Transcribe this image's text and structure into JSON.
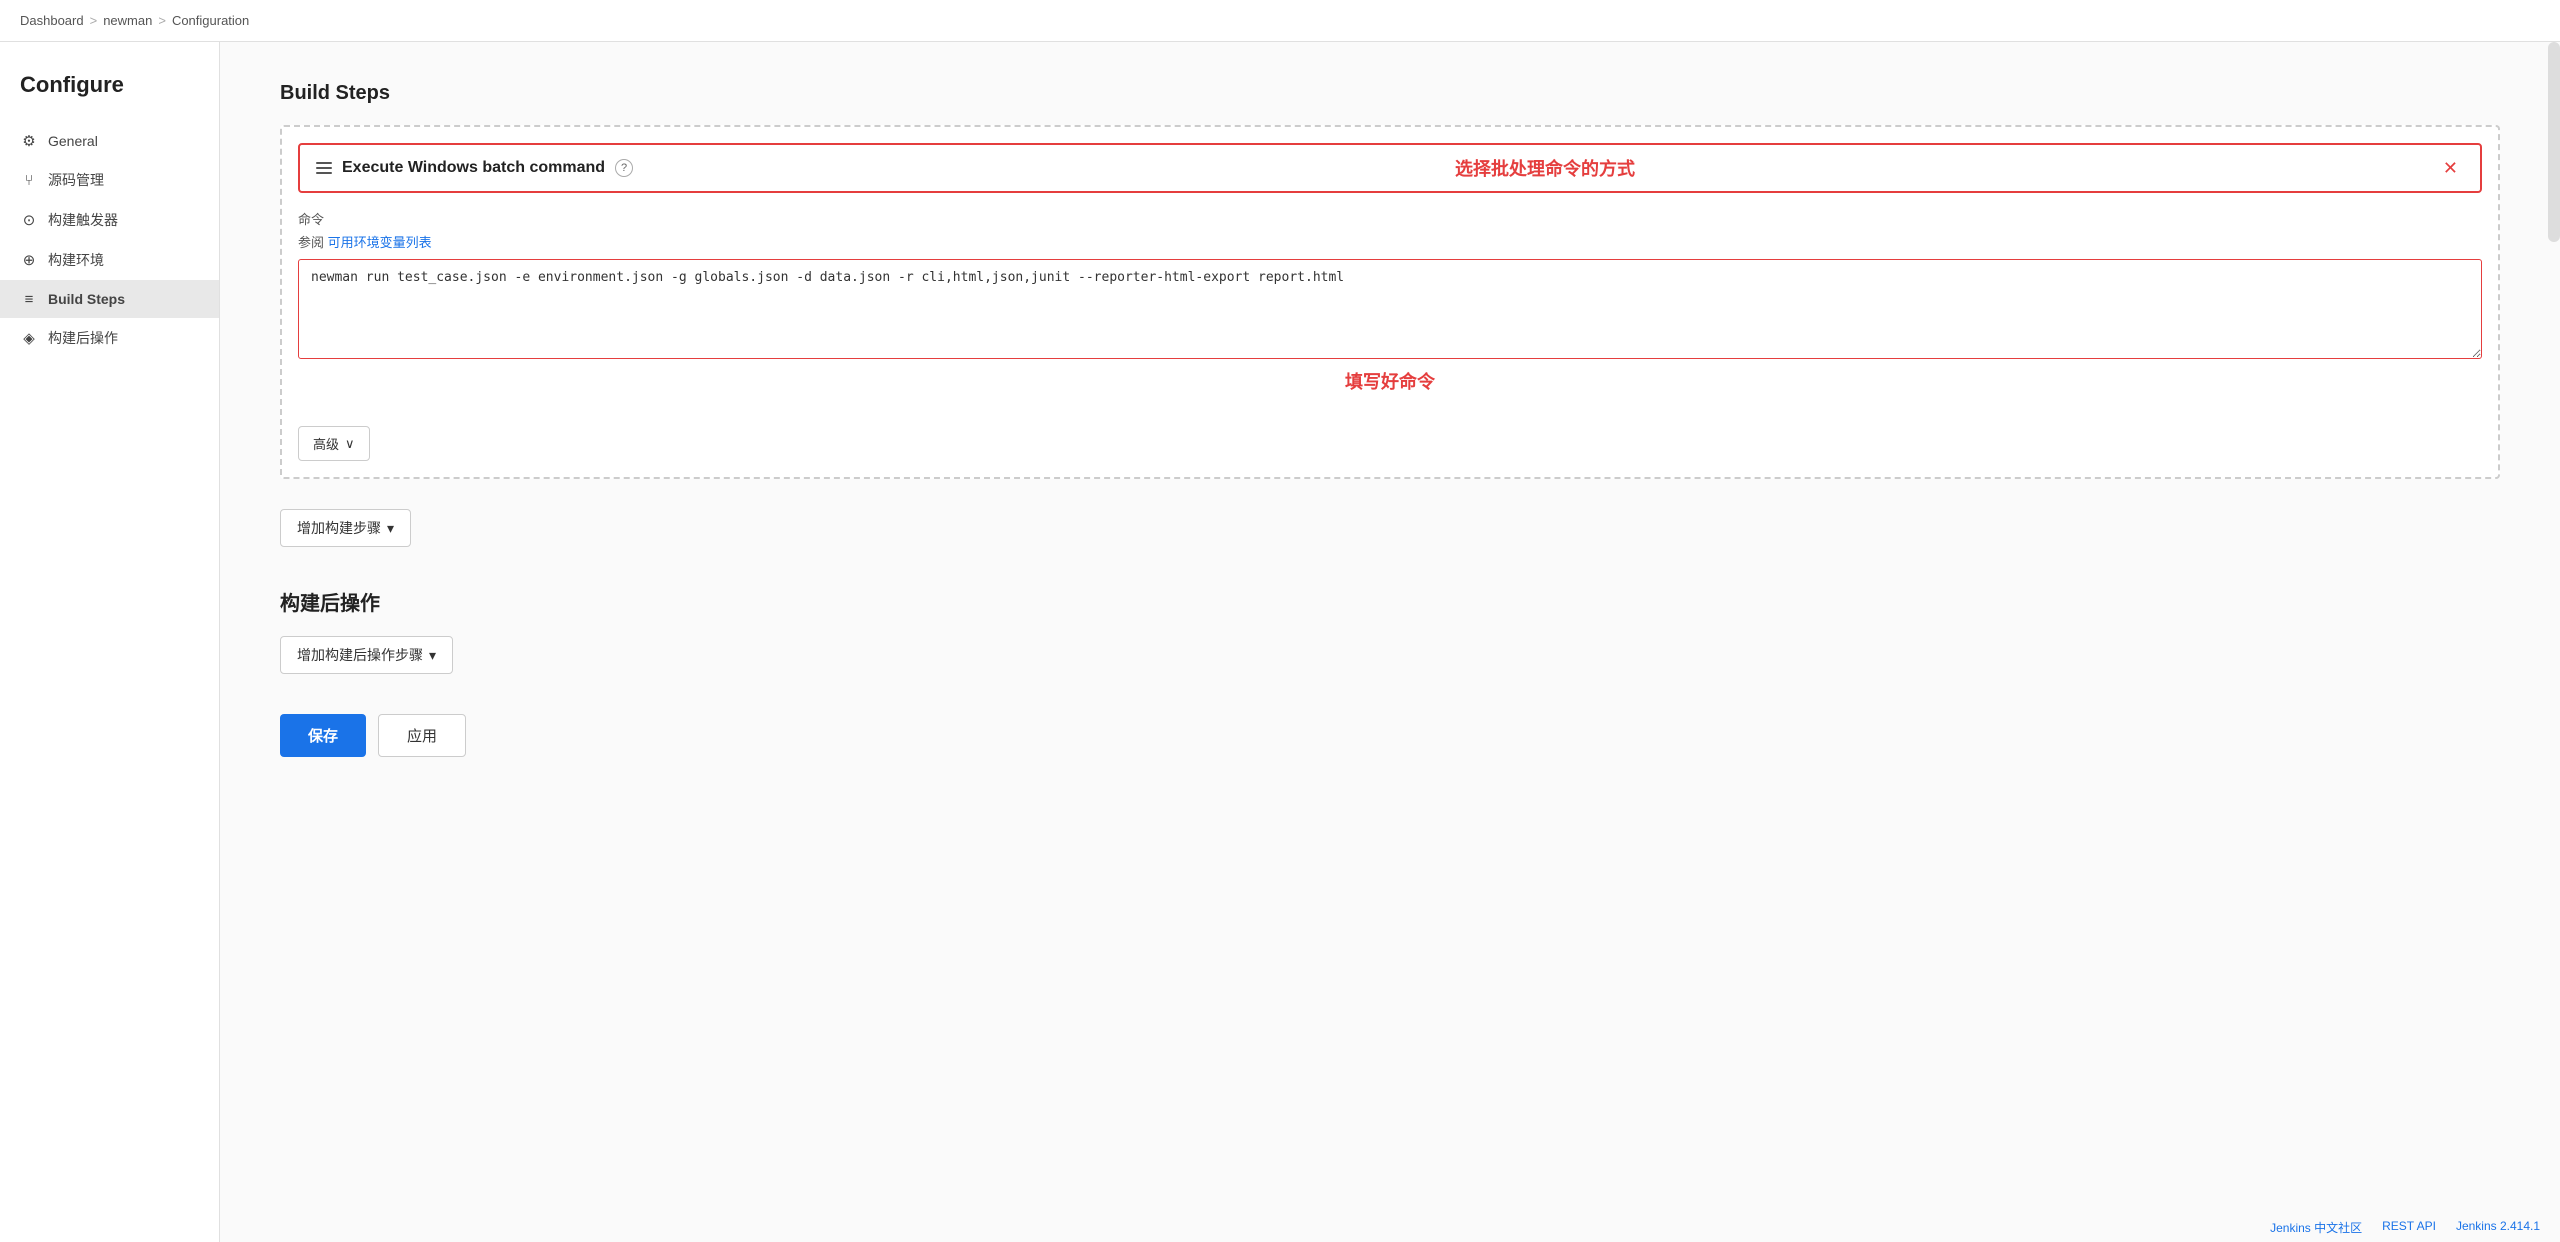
{
  "breadcrumb": {
    "items": [
      "Dashboard",
      "newman",
      "Configuration"
    ],
    "separators": [
      ">",
      ">"
    ]
  },
  "sidebar": {
    "title": "Configure",
    "items": [
      {
        "id": "general",
        "label": "General",
        "icon": "⚙"
      },
      {
        "id": "source",
        "label": "源码管理",
        "icon": "⑂"
      },
      {
        "id": "triggers",
        "label": "构建触发器",
        "icon": "⊙"
      },
      {
        "id": "env",
        "label": "构建环境",
        "icon": "⊕"
      },
      {
        "id": "buildsteps",
        "label": "Build Steps",
        "icon": "≡",
        "active": true
      },
      {
        "id": "postbuild",
        "label": "构建后操作",
        "icon": "◈"
      }
    ]
  },
  "main": {
    "buildSteps": {
      "sectionTitle": "Build Steps",
      "stepCard": {
        "headerTitle": "Execute Windows batch command",
        "helpLabel": "?",
        "annotation": "选择批处理命令的方式",
        "fieldLabel": "命令",
        "fieldNote": "参阅",
        "fieldNoteLink": "可用环境变量列表",
        "commandValue": "newman run test_case.json -e environment.json -g globals.json -d data.json -r cli,html,json,junit --reporter-html-export report.html",
        "textareaAnnotation": "填写好命令",
        "advancedLabel": "高级",
        "advancedChevron": "∨"
      },
      "addStepLabel": "增加构建步骤",
      "addStepChevron": "▾"
    },
    "postBuild": {
      "sectionTitle": "构建后操作",
      "addPostLabel": "增加构建后操作步骤",
      "addPostChevron": "▾"
    },
    "actions": {
      "saveLabel": "保存",
      "applyLabel": "应用"
    }
  },
  "footer": {
    "links": [
      "Jenkins 中文社区",
      "REST API",
      "Jenkins 2.414.1"
    ]
  },
  "colors": {
    "accent": "#e53e3e",
    "link": "#1a73e8",
    "activeSidebar": "#e8e8e8"
  }
}
